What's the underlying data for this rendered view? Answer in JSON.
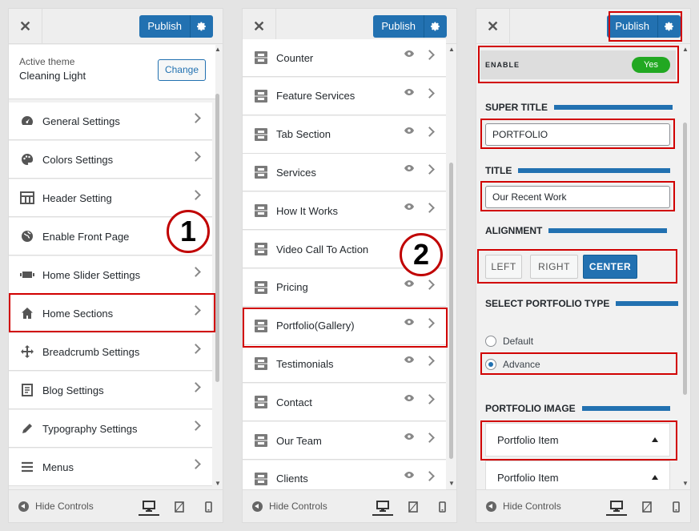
{
  "common": {
    "publish_label": "Publish",
    "hide_controls": "Hide Controls",
    "close_glyph": "✕"
  },
  "panel1": {
    "active_theme_label": "Active theme",
    "theme_name": "Cleaning Light",
    "change_label": "Change",
    "items": [
      {
        "label": "General Settings",
        "icon": "dashboard-icon"
      },
      {
        "label": "Colors Settings",
        "icon": "palette-icon"
      },
      {
        "label": "Header Setting",
        "icon": "layout-icon"
      },
      {
        "label": "Enable Front Page",
        "icon": "globe-icon"
      },
      {
        "label": "Home Slider Settings",
        "icon": "slider-icon"
      },
      {
        "label": "Home Sections",
        "icon": "home-icon"
      },
      {
        "label": "Breadcrumb Settings",
        "icon": "move-icon"
      },
      {
        "label": "Blog Settings",
        "icon": "document-icon"
      },
      {
        "label": "Typography Settings",
        "icon": "pen-icon"
      },
      {
        "label": "Menus",
        "icon": "menu-icon"
      }
    ],
    "badge": "1"
  },
  "panel2": {
    "items": [
      {
        "label": "Counter"
      },
      {
        "label": "Feature Services"
      },
      {
        "label": "Tab Section"
      },
      {
        "label": "Services"
      },
      {
        "label": "How It Works"
      },
      {
        "label": "Video Call To Action"
      },
      {
        "label": "Pricing"
      },
      {
        "label": "Portfolio(Gallery)"
      },
      {
        "label": "Testimonials"
      },
      {
        "label": "Contact"
      },
      {
        "label": "Our Team"
      },
      {
        "label": "Clients"
      }
    ],
    "badge": "2"
  },
  "panel3": {
    "enable_label": "ENABLE",
    "enable_value": "Yes",
    "super_title_label": "SUPER TITLE",
    "super_title_value": "PORTFOLIO",
    "title_label": "TITLE",
    "title_value": "Our Recent Work",
    "alignment_label": "ALIGNMENT",
    "align_options": [
      "LEFT",
      "RIGHT",
      "CENTER"
    ],
    "align_selected": "CENTER",
    "portfolio_type_label": "SELECT PORTFOLIO TYPE",
    "portfolio_types": [
      "Default",
      "Advance"
    ],
    "portfolio_type_selected": "Advance",
    "portfolio_image_label": "PORTFOLIO IMAGE",
    "portfolio_items": [
      "Portfolio Item",
      "Portfolio Item"
    ]
  },
  "colors": {
    "accent": "#2271b1",
    "highlight": "#d10000",
    "toggle_on": "#22a822"
  }
}
